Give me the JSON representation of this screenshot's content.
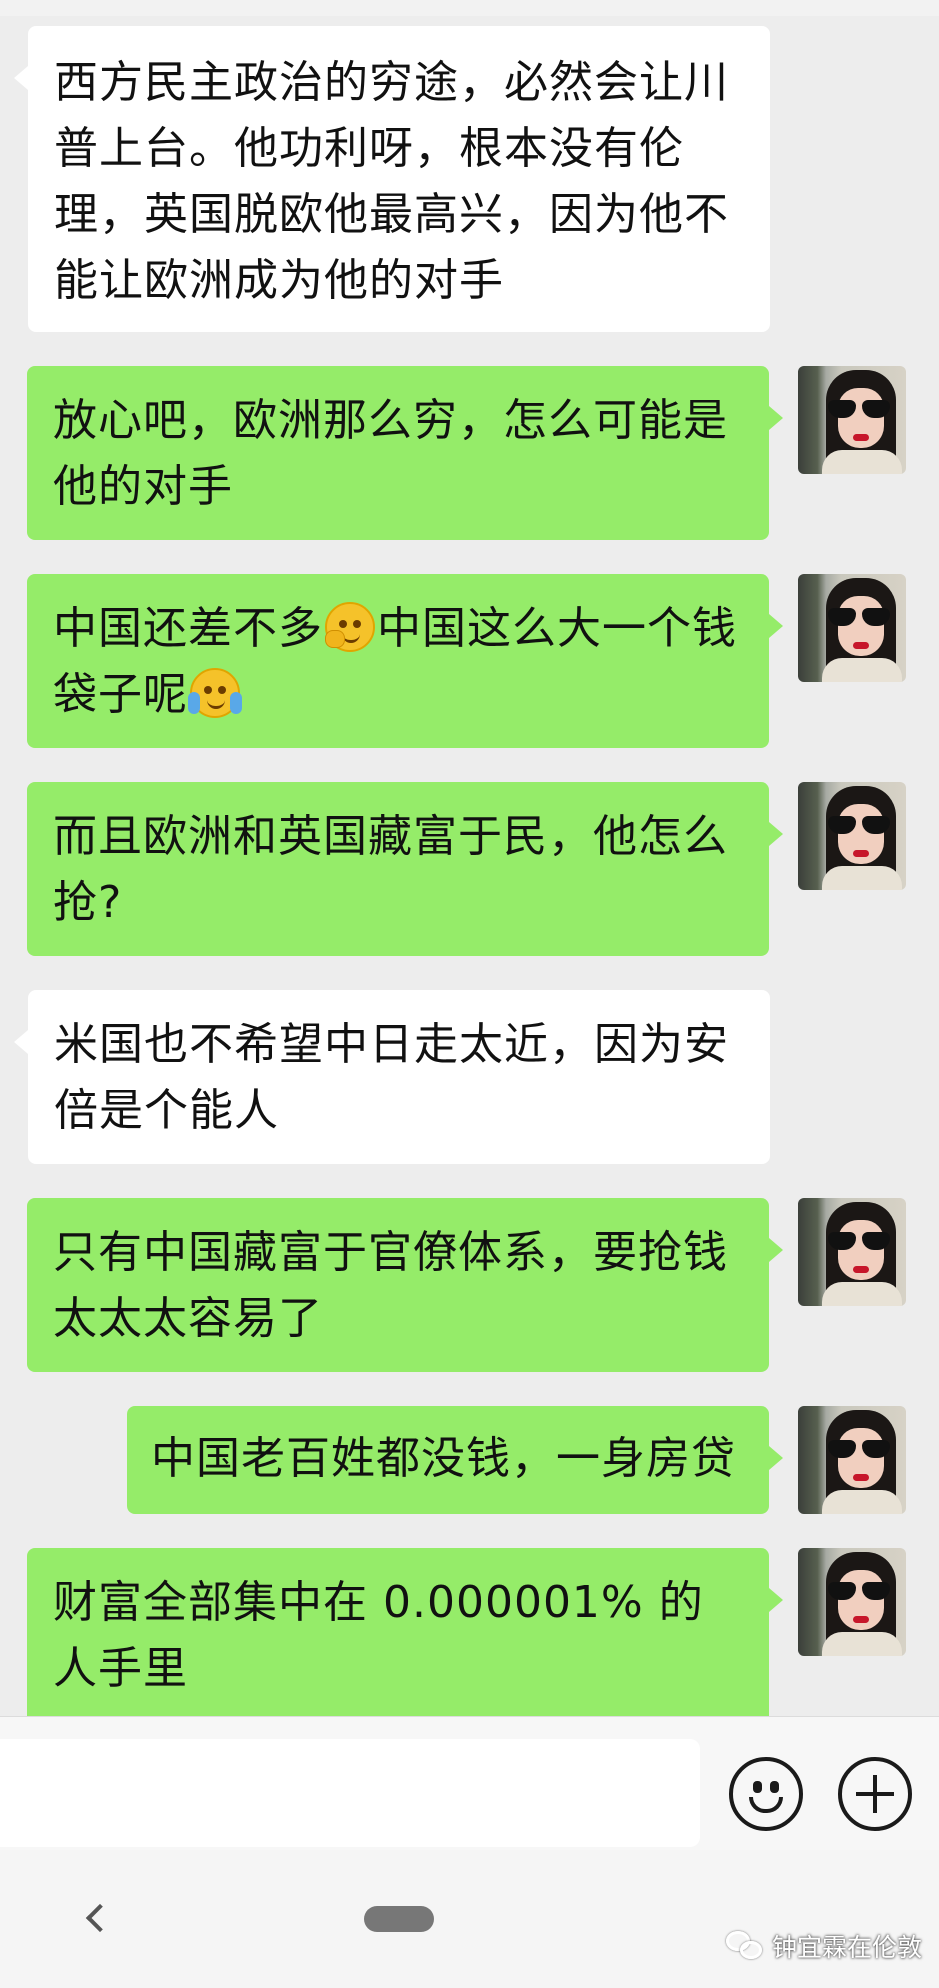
{
  "messages": [
    {
      "side": "left",
      "text": "西方民主政治的穷途，必然会让川普上台。他功利呀，根本没有伦理，英国脱欧他最高兴，因为他不能让欧洲成为他的对手"
    },
    {
      "side": "right",
      "text": "放心吧，欧洲那么穷，怎么可能是他的对手"
    },
    {
      "side": "right",
      "text_a": "中国还差不多",
      "emoji_a": "thinking-face-emoji",
      "text_b": "中国这么大一个钱袋子呢",
      "emoji_b": "laugh-cry-emoji"
    },
    {
      "side": "right",
      "text": "而且欧洲和英国藏富于民，他怎么抢?"
    },
    {
      "side": "left",
      "text": "米国也不希望中日走太近，因为安倍是个能人"
    },
    {
      "side": "right",
      "text": "只有中国藏富于官僚体系，要抢钱太太太容易了"
    },
    {
      "side": "right",
      "text": "中国老百姓都没钱，一身房贷"
    },
    {
      "side": "right",
      "text": "财富全部集中在 0.000001% 的人手里"
    }
  ],
  "input": {
    "placeholder": ""
  },
  "toolbar": {
    "emoji_icon": "smiley-icon",
    "plus_icon": "plus-icon"
  },
  "watermark": {
    "text": "钟宜霖在伦敦"
  },
  "colors": {
    "background": "#ededed",
    "sent_bubble": "#95ec69",
    "received_bubble": "#ffffff"
  }
}
